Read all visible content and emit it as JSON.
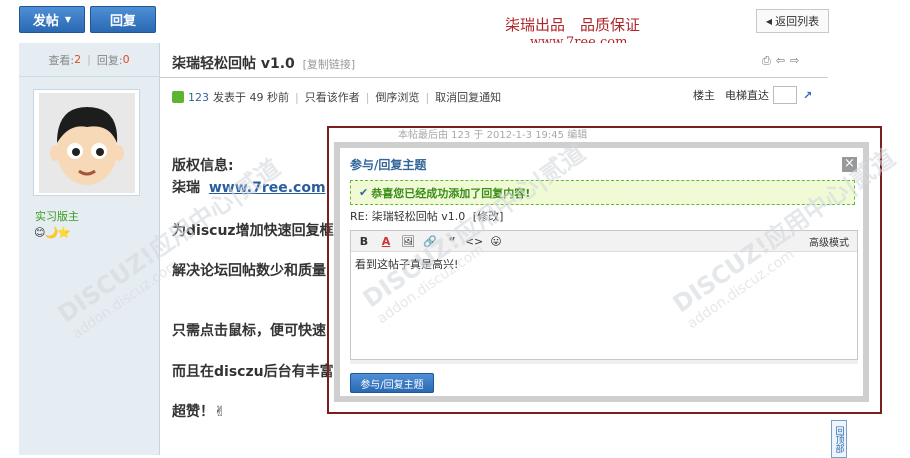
{
  "toolbar": {
    "post_label": "发帖",
    "reply_label": "回复",
    "return_label": "返回列表"
  },
  "brand": {
    "slogan": "柒瑞出品　品质保证",
    "url": "www.7ree.com"
  },
  "sidebar": {
    "views_label": "查看:",
    "views_value": "2",
    "replies_label": "回复:",
    "replies_value": "0",
    "user_group": "实习版主",
    "emoji_icons": "😊🌙⭐"
  },
  "thread": {
    "title": "柒瑞轻松回帖 v1.0",
    "copy_link": "[复制链接]",
    "post_meta_uid": "123",
    "post_meta_time": "发表于 49 秒前",
    "only_author": "只看该作者",
    "reverse_view": "倒序浏览",
    "cancel_notify": "取消回复通知",
    "floor_label": "楼主",
    "elevator_label": "电梯直达",
    "edit_notice": "本帖最后由 123 于 2012-1-3 19:45 编辑",
    "body_copyright": "版权信息:",
    "body_author_prefix": "柒瑞",
    "body_author_link": "www.7ree.com",
    "body_line1": "为discuz增加快速回复框",
    "body_line2": "解决论坛回帖数少和质量",
    "body_line3": "只需点击鼠标，便可快速",
    "body_line4": "而且在disczu后台有丰富",
    "body_line5": "超赞！✌"
  },
  "dialog": {
    "title": "参与/回复主题",
    "success_msg": "恭喜您已经成功添加了回复内容!",
    "reply_subject": "RE: 柒瑞轻松回帖 v1.0",
    "modify_link": "[修改]",
    "advanced_mode": "高级模式",
    "editor_content": "看到这帖子真是高兴!",
    "submit_label": "参与/回复主题",
    "close_label": "×"
  },
  "side_float": {
    "top_label": "回顶部"
  },
  "watermark": {
    "main": "DISCUZ!应用中心|贰道",
    "sub": "addon.discuz.com"
  },
  "colors": {
    "accent_blue": "#2a69b3",
    "brand_red": "#b0252a",
    "dialog_border": "#7b1e1e",
    "success_green": "#3a8c1a"
  }
}
